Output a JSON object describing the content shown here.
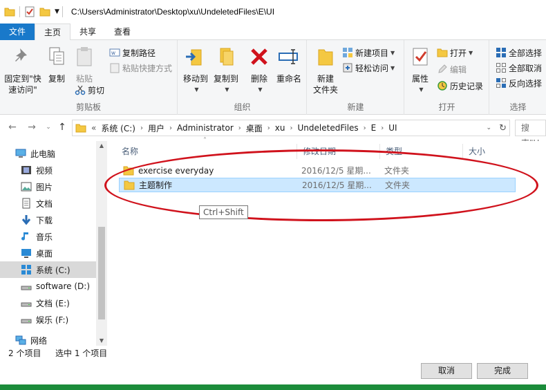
{
  "window": {
    "title_path": "C:\\Users\\Administrator\\Desktop\\xu\\UndeletedFiles\\E\\UI"
  },
  "tabs": [
    {
      "label": "文件"
    },
    {
      "label": "主页"
    },
    {
      "label": "共享"
    },
    {
      "label": "查看"
    }
  ],
  "ribbon": {
    "clipboard": {
      "label": "剪贴板",
      "pin_quick": "固定到\"快速访问\"",
      "pin_quick_line1": "固定到\"快",
      "pin_quick_line2": "速访问\"",
      "copy": "复制",
      "paste": "粘贴",
      "copy_path": "复制路径",
      "paste_shortcut": "粘贴快捷方式",
      "cut": "剪切"
    },
    "organize": {
      "label": "组织",
      "move_to": "移动到",
      "copy_to": "复制到",
      "delete": "删除",
      "rename": "重命名"
    },
    "new": {
      "label": "新建",
      "new_folder_line1": "新建",
      "new_folder_line2": "文件夹",
      "new_item": "新建项目",
      "easy_access": "轻松访问"
    },
    "open": {
      "label": "打开",
      "properties": "属性",
      "open": "打开",
      "edit": "编辑",
      "history": "历史记录"
    },
    "select": {
      "label": "选择",
      "select_all": "全部选择",
      "select_none": "全部取消",
      "invert": "反向选择"
    }
  },
  "address": {
    "crumbs": [
      "系统 (C:)",
      "用户",
      "Administrator",
      "桌面",
      "xu",
      "UndeletedFiles",
      "E",
      "UI"
    ],
    "overflow": "«",
    "search_placeholder": "搜索\"U"
  },
  "nav": {
    "items": [
      {
        "label": "此电脑",
        "icon": "computer-icon"
      },
      {
        "label": "视频",
        "icon": "video-icon"
      },
      {
        "label": "图片",
        "icon": "pictures-icon"
      },
      {
        "label": "文档",
        "icon": "documents-icon"
      },
      {
        "label": "下载",
        "icon": "download-icon"
      },
      {
        "label": "音乐",
        "icon": "music-icon"
      },
      {
        "label": "桌面",
        "icon": "desktop-icon"
      },
      {
        "label": "系统 (C:)",
        "icon": "system-drive-icon"
      },
      {
        "label": "software (D:)",
        "icon": "drive-icon"
      },
      {
        "label": "文档 (E:)",
        "icon": "drive-icon"
      },
      {
        "label": "娱乐 (F:)",
        "icon": "drive-icon"
      },
      {
        "label": "网络",
        "icon": "network-icon"
      }
    ],
    "selected_index": 7
  },
  "columns": {
    "name": "名称",
    "date": "修改日期",
    "type": "类型",
    "size": "大小"
  },
  "files": [
    {
      "name": "exercise everyday",
      "date": "2016/12/5 星期...",
      "type": "文件夹"
    },
    {
      "name": "主题制作",
      "date": "2016/12/5 星期...",
      "type": "文件夹"
    }
  ],
  "tooltip": "Ctrl+Shift",
  "status": {
    "count": "2 个项目",
    "selected": "选中 1 个项目"
  },
  "dialog": {
    "back": "取消",
    "finish": "完成"
  },
  "colors": {
    "accent": "#1979ca",
    "highlight": "#d0121c",
    "selection": "#cce8ff"
  }
}
